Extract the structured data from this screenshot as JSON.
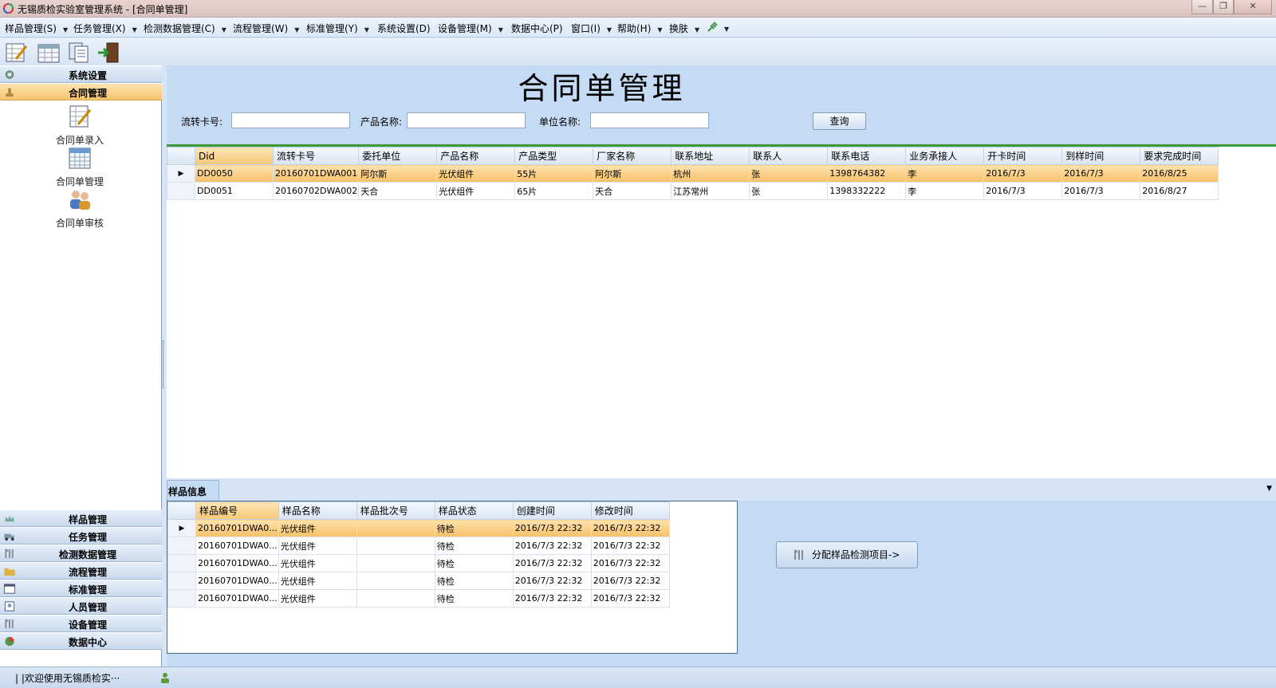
{
  "window": {
    "title": "无锡质检实验室管理系统 - [合同单管理]"
  },
  "menu": [
    {
      "label": "样品管理(S)"
    },
    {
      "label": "任务管理(X)"
    },
    {
      "label": "检测数据管理(C)"
    },
    {
      "label": "流程管理(W)"
    },
    {
      "label": "标准管理(Y)"
    },
    {
      "label": "系统设置(D)"
    },
    {
      "label": "设备管理(M)"
    },
    {
      "label": "数据中心(P)"
    },
    {
      "label": "窗口(I)"
    },
    {
      "label": "帮助(H)"
    },
    {
      "label": "换肤"
    }
  ],
  "nav": {
    "groups_top": [
      "系统设置",
      "合同管理"
    ],
    "tools": [
      "合同单录入",
      "合同单管理",
      "合同单审核"
    ],
    "groups_bottom": [
      "样品管理",
      "任务管理",
      "检测数据管理",
      "流程管理",
      "标准管理",
      "人员管理",
      "设备管理",
      "数据中心"
    ]
  },
  "page": {
    "title": "合同单管理",
    "filters": {
      "card_label": "流转卡号:",
      "product_label": "产品名称:",
      "unit_label": "单位名称:"
    },
    "query_label": "查询"
  },
  "contract_grid": {
    "columns": [
      "Did",
      "流转卡号",
      "委托单位",
      "产品名称",
      "产品类型",
      "厂家名称",
      "联系地址",
      "联系人",
      "联系电话",
      "业务承接人",
      "开卡时间",
      "到样时间",
      "要求完成时间"
    ],
    "rows": [
      [
        "DD0050",
        "20160701DWA001",
        "阿尔斯",
        "光伏组件",
        "55片",
        "阿尔斯",
        "杭州",
        "张",
        "1398764382",
        "李",
        "2016/7/3",
        "2016/7/3",
        "2016/8/25"
      ],
      [
        "DD0051",
        "20160702DWA002",
        "天合",
        "光伏组件",
        "65片",
        "天合",
        "江苏常州",
        "张",
        "1398332222",
        "李",
        "2016/7/3",
        "2016/7/3",
        "2016/8/27"
      ]
    ]
  },
  "sample_panel": {
    "tab_label": "样品信息",
    "columns": [
      "样品编号",
      "样品名称",
      "样品批次号",
      "样品状态",
      "创建时间",
      "修改时间"
    ],
    "rows": [
      [
        "20160701DWA0...",
        "光伏组件",
        "",
        "待检",
        "2016/7/3 22:32",
        "2016/7/3 22:32"
      ],
      [
        "20160701DWA0...",
        "光伏组件",
        "",
        "待检",
        "2016/7/3 22:32",
        "2016/7/3 22:32"
      ],
      [
        "20160701DWA0...",
        "光伏组件",
        "",
        "待检",
        "2016/7/3 22:32",
        "2016/7/3 22:32"
      ],
      [
        "20160701DWA0...",
        "光伏组件",
        "",
        "待检",
        "2016/7/3 22:32",
        "2016/7/3 22:32"
      ],
      [
        "20160701DWA0...",
        "光伏组件",
        "",
        "待检",
        "2016/7/3 22:32",
        "2016/7/3 22:32"
      ]
    ],
    "assign_label": "分配样品检测项目->"
  },
  "status": {
    "text": "| |欢迎使用无锡质检实···"
  }
}
